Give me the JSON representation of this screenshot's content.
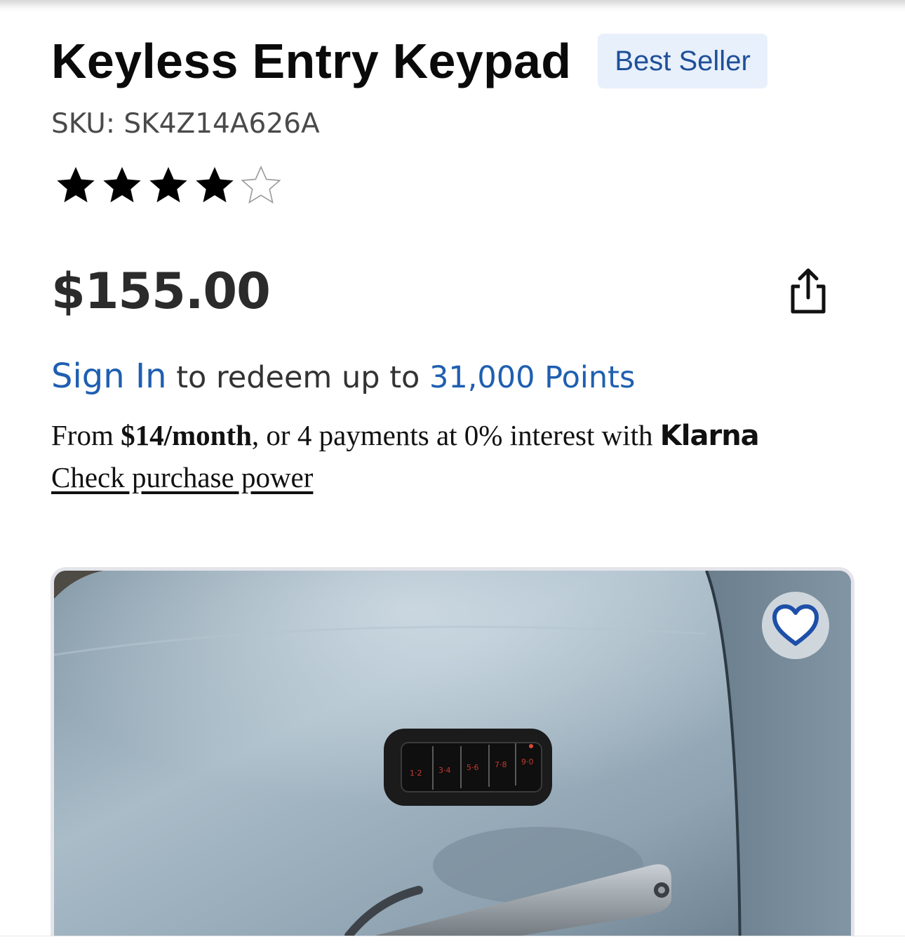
{
  "product": {
    "title": "Keyless Entry Keypad",
    "badge": "Best Seller",
    "sku": "SKU: SK4Z14A626A",
    "rating": {
      "value": 4,
      "max": 5
    },
    "price": "$155.00"
  },
  "points": {
    "sign_in": "Sign In",
    "middle": " to redeem up to ",
    "points": "31,000 Points"
  },
  "klarna": {
    "prefix": "From ",
    "monthly": "$14/month",
    "middle": ", or 4 payments at 0% interest with ",
    "brand": "Klarna",
    "check_link": "Check purchase power"
  },
  "image": {
    "keypad_labels": [
      "1·2",
      "3·4",
      "5·6",
      "7·8",
      "9·0"
    ]
  },
  "icons": {
    "share": "share-icon",
    "favorite": "heart-icon",
    "star_filled": "star-filled-icon",
    "star_empty": "star-empty-icon"
  },
  "colors": {
    "link": "#1f5fb0",
    "badge_bg": "#e7f0fb",
    "badge_text": "#1f4f99",
    "heart": "#1e4fa8"
  }
}
